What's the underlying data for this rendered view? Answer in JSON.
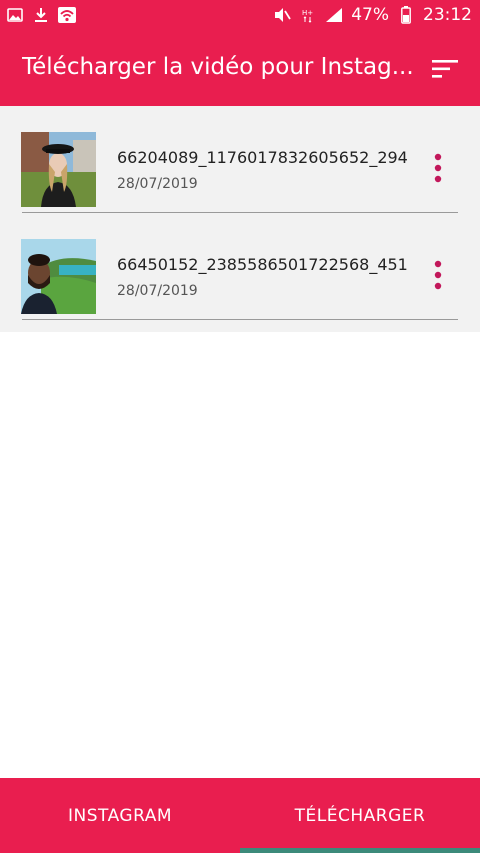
{
  "status_bar": {
    "battery_percent": "47%",
    "time": "23:12",
    "left_icons": [
      "image-icon",
      "download-icon",
      "wifi-icon"
    ],
    "right_icons": [
      "mute-icon",
      "signal-hplus-icon",
      "cell-signal-icon",
      "battery-icon"
    ]
  },
  "app_bar": {
    "title": "Télécharger la vidéo pour Instag...",
    "sort_icon": "sort-icon"
  },
  "videos": [
    {
      "name": "66204089_1176017832605652_294...",
      "date": "28/07/2019"
    },
    {
      "name": "66450152_2385586501722568_451...",
      "date": "28/07/2019"
    }
  ],
  "bottom_nav": {
    "tabs": [
      {
        "label": "INSTAGRAM",
        "selected": false
      },
      {
        "label": "TÉLÉCHARGER",
        "selected": true
      }
    ],
    "indicator_color": "#3c8a7a"
  },
  "colors": {
    "primary": "#e91e4f",
    "list_bg": "#f2f2f2"
  }
}
